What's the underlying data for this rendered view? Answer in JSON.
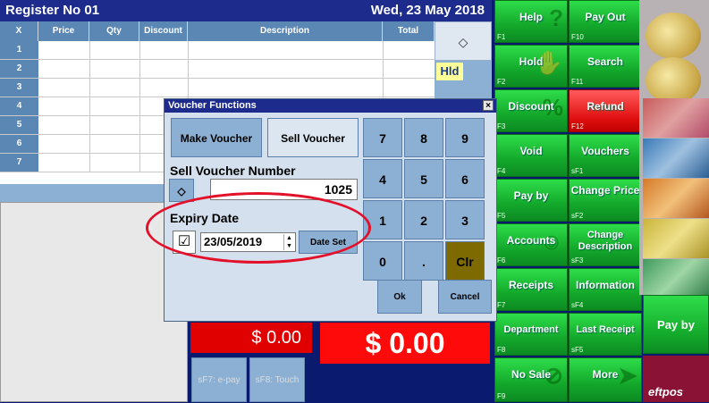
{
  "register": {
    "title": "Register No 01",
    "date": "Wed, 23 May 2018"
  },
  "grid": {
    "columns": [
      "X",
      "Price",
      "Qty",
      "Discount",
      "Description",
      "Total"
    ],
    "rows": [
      "1",
      "2",
      "3",
      "4",
      "5",
      "6",
      "7"
    ],
    "hold_label": "Hld"
  },
  "totals": {
    "line_total": "$ 0.00",
    "grand_total": "$ 0.00"
  },
  "pay_buttons": [
    "sF7: e-pay",
    "sF8: Touch"
  ],
  "function_buttons": [
    {
      "label": "Help",
      "key": "F1"
    },
    {
      "label": "Pay Out",
      "key": "F10"
    },
    {
      "label": "Hold",
      "key": "F2"
    },
    {
      "label": "Search",
      "key": "F11"
    },
    {
      "label": "Discount",
      "key": "F3"
    },
    {
      "label": "Refund",
      "key": "F12"
    },
    {
      "label": "Void",
      "key": "F4"
    },
    {
      "label": "Vouchers",
      "key": "sF1"
    },
    {
      "label": "Pay by",
      "key": "F5"
    },
    {
      "label": "Change Price",
      "key": "sF2"
    },
    {
      "label": "Accounts",
      "key": "F6"
    },
    {
      "label": "Change Description",
      "key": "sF3"
    },
    {
      "label": "Receipts",
      "key": "F7"
    },
    {
      "label": "Information",
      "key": "sF4"
    },
    {
      "label": "Department",
      "key": "F8"
    },
    {
      "label": "Last Receipt",
      "key": "sF5"
    },
    {
      "label": "No Sale",
      "key": "F9"
    },
    {
      "label": "More",
      "key": ""
    }
  ],
  "right_strip": {
    "pay_by": "Pay by",
    "eftpos": "eftpos"
  },
  "dialog": {
    "title": "Voucher Functions",
    "close": "×",
    "make_voucher": "Make Voucher",
    "sell_voucher": "Sell Voucher",
    "sell_number_label": "Sell Voucher Number",
    "sell_number_value": "1025",
    "expiry_label": "Expiry Date",
    "expiry_checked": true,
    "expiry_value": "23/05/2019",
    "date_set": "Date Set",
    "keypad": [
      "7",
      "8",
      "9",
      "4",
      "5",
      "6",
      "1",
      "2",
      "3",
      "0",
      ".",
      "Clr"
    ],
    "ok": "Ok",
    "cancel": "Cancel"
  },
  "colors": {
    "accent_green": "#13a82b",
    "accent_red": "#e00000",
    "header_blue": "#1d2b8c",
    "highlight_circle": "#e3102a"
  }
}
